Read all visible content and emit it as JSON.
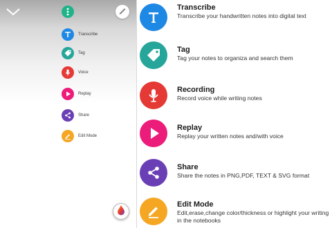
{
  "colors": {
    "teal": "#1fb38a",
    "blue": "#1e88e5",
    "cyan": "#26a69a",
    "red": "#e53935",
    "pink": "#ec1c7a",
    "purple": "#6a3fb5",
    "amber": "#f5a623"
  },
  "phone": {
    "menu": [
      {
        "label": "Transcribe",
        "icon": "transcribe-icon"
      },
      {
        "label": "Tag",
        "icon": "tag-icon"
      },
      {
        "label": "Voice",
        "icon": "microphone-icon"
      },
      {
        "label": "Replay",
        "icon": "play-icon"
      },
      {
        "label": "Share",
        "icon": "share-icon"
      },
      {
        "label": "Edit Mode",
        "icon": "pencil-icon"
      }
    ]
  },
  "features": [
    {
      "title": "Transcribe",
      "description": "Transcribe your handwritten notes into digital text",
      "icon": "transcribe-icon"
    },
    {
      "title": "Tag",
      "description": "Tag your notes to organiza and search them",
      "icon": "tag-icon"
    },
    {
      "title": "Recording",
      "description": "Record voice while writing notes",
      "icon": "microphone-icon"
    },
    {
      "title": "Replay",
      "description": "Replay your written notes and/with voice",
      "icon": "play-icon"
    },
    {
      "title": "Share",
      "description": "Share the notes in PNG,PDF, TEXT & SVG format",
      "icon": "share-icon"
    },
    {
      "title": "Edit Mode",
      "description": "Edit,erase,change color/thickness or highlight your writing in the notebooks",
      "icon": "pencil-icon"
    }
  ]
}
